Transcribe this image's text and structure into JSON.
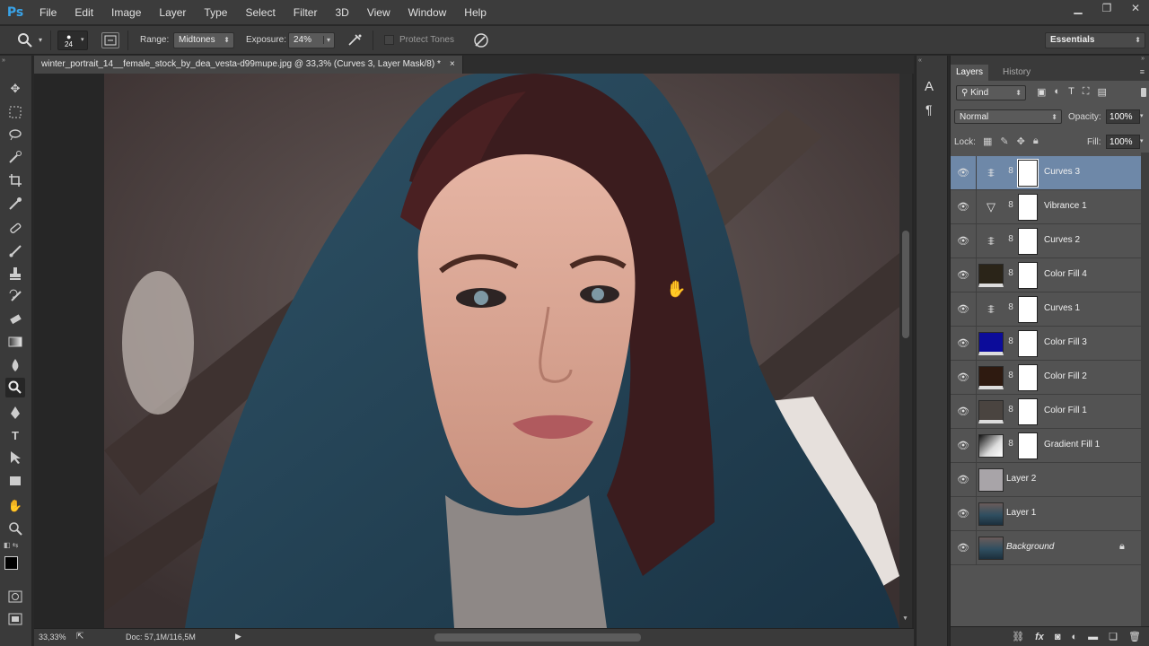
{
  "app": {
    "logo": "Ps"
  },
  "menu": [
    "File",
    "Edit",
    "Image",
    "Layer",
    "Type",
    "Select",
    "Filter",
    "3D",
    "View",
    "Window",
    "Help"
  ],
  "options": {
    "brush_size": "24",
    "range_label": "Range:",
    "range_value": "Midtones",
    "exposure_label": "Exposure:",
    "exposure_value": "24%",
    "protect_tones": "Protect Tones",
    "workspace": "Essentials"
  },
  "document": {
    "tab_title": "winter_portrait_14__female_stock_by_dea_vesta-d99mupe.jpg @ 33,3% (Curves 3, Layer Mask/8) *",
    "close": "×"
  },
  "status": {
    "zoom": "33,33%",
    "doc_size": "Doc: 57,1M/116,5M"
  },
  "layers_panel": {
    "tabs": [
      "Layers",
      "History"
    ],
    "filter_kind": "Kind",
    "blend_mode": "Normal",
    "opacity_label": "Opacity:",
    "opacity_value": "100%",
    "lock_label": "Lock:",
    "fill_label": "Fill:",
    "fill_value": "100%",
    "layers": [
      {
        "name": "Curves 3",
        "kind": "curves",
        "selected": true
      },
      {
        "name": "Vibrance 1",
        "kind": "vibrance"
      },
      {
        "name": "Curves 2",
        "kind": "curves"
      },
      {
        "name": "Color Fill 4",
        "kind": "fill",
        "color": "#2a2418"
      },
      {
        "name": "Curves 1",
        "kind": "curves"
      },
      {
        "name": "Color Fill 3",
        "kind": "fill",
        "color": "#0c0c9a"
      },
      {
        "name": "Color Fill 2",
        "kind": "fill",
        "color": "#2e1a10"
      },
      {
        "name": "Color Fill 1",
        "kind": "fill",
        "color": "#4a4440"
      },
      {
        "name": "Gradient Fill 1",
        "kind": "gradient"
      },
      {
        "name": "Layer 2",
        "kind": "plain",
        "color": "#a8a4a8"
      },
      {
        "name": "Layer 1",
        "kind": "photo"
      },
      {
        "name": "Background",
        "kind": "photo",
        "locked": true
      }
    ]
  },
  "colors": {
    "selected_layer": "#6e88a8",
    "ps_blue": "#39a3e8"
  }
}
